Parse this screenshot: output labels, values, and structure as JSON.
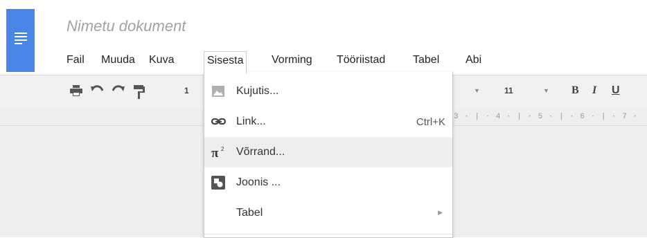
{
  "app": {
    "title": "Nimetu dokument"
  },
  "menubar": {
    "items": [
      "Fail",
      "Muuda",
      "Kuva",
      "Sisesta",
      "Vorming",
      "Tööriistad",
      "Tabel",
      "Abi"
    ],
    "open_item": "Sisesta"
  },
  "toolbar": {
    "icons": [
      "print-icon",
      "undo-icon",
      "redo-icon",
      "paint-format-icon"
    ],
    "zoom_partial": "1",
    "font_size": "11",
    "bold": "B",
    "italic": "I",
    "underline": "U"
  },
  "ruler": {
    "marks": "3 · | · 4 · | · 5 · | · 6 · | · 7 ·"
  },
  "insert_menu": {
    "items": [
      {
        "label": "Kujutis...",
        "icon": "image-icon",
        "shortcut": "",
        "submenu": false
      },
      {
        "label": "Link...",
        "icon": "link-icon",
        "shortcut": "Ctrl+K",
        "submenu": false
      },
      {
        "label": "Võrrand...",
        "icon": "equation-icon",
        "shortcut": "",
        "submenu": false
      },
      {
        "label": "Joonis ...",
        "icon": "drawing-icon",
        "shortcut": "",
        "submenu": false
      },
      {
        "label": "Tabel",
        "icon": "",
        "shortcut": "",
        "submenu": true
      }
    ],
    "highlighted_index": 2
  },
  "colors": {
    "brand": "#4a86e8",
    "toolbar_bg": "#f1f1f1",
    "hover_bg": "#eeeeee"
  }
}
